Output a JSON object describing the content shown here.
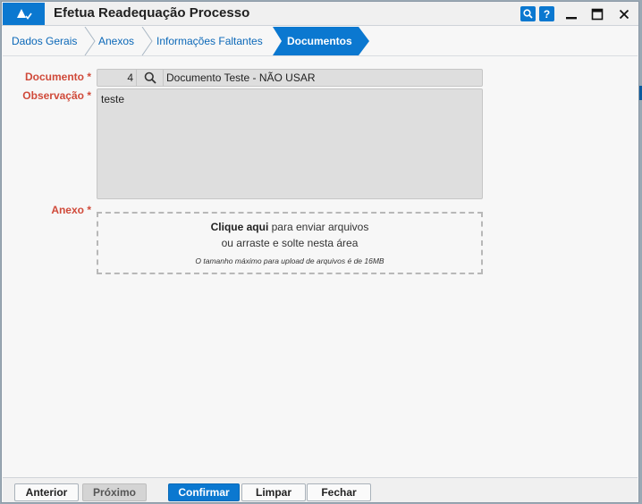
{
  "window": {
    "title": "Efetua Readequação Processo",
    "help_search_icon": "search-icon",
    "help_icon_label": "?"
  },
  "tabs": [
    {
      "label": "Dados Gerais"
    },
    {
      "label": "Anexos"
    },
    {
      "label": "Informações Faltantes"
    },
    {
      "label": "Documentos"
    }
  ],
  "active_tab_index": 3,
  "form": {
    "documento": {
      "label": "Documento *",
      "number": "4",
      "description": "Documento Teste - NÃO USAR"
    },
    "observacao": {
      "label": "Observação *",
      "value": "teste"
    },
    "anexo": {
      "label": "Anexo *",
      "link_text": "Clique aqui",
      "line1_rest": " para enviar arquivos",
      "line2": "ou arraste e solte nesta área",
      "note": "O tamanho máximo para upload de arquivos é de 16MB"
    }
  },
  "footer": {
    "anterior": "Anterior",
    "proximo": "Próximo",
    "confirmar": "Confirmar",
    "limpar": "Limpar",
    "fechar": "Fechar"
  },
  "colors": {
    "accent": "#0b78d0",
    "required_label": "#d04a3a",
    "tab_text": "#0b68b8"
  }
}
